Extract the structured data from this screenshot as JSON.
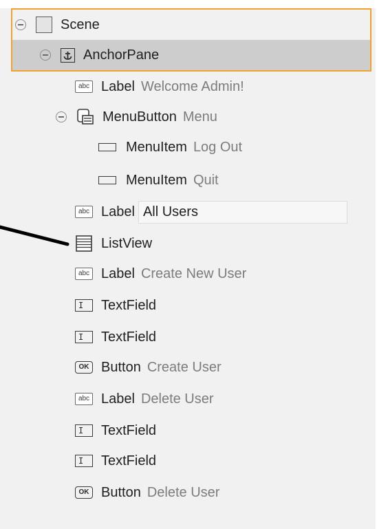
{
  "hierarchy": {
    "scene": {
      "type": "Scene",
      "icon": "scene-icon"
    },
    "anchor": {
      "type": "AnchorPane",
      "icon": "anchor-icon",
      "glyph": "⚓"
    },
    "items": [
      {
        "type": "Label",
        "detail": "Welcome Admin!",
        "icon": "label-icon"
      },
      {
        "type": "MenuButton",
        "detail": "Menu",
        "icon": "menubutton-icon"
      },
      {
        "type": "MenuItem",
        "detail": "Log Out",
        "icon": "menuitem-icon"
      },
      {
        "type": "MenuItem",
        "detail": "Quit",
        "icon": "menuitem-icon"
      },
      {
        "type": "Label",
        "detail": "All Users",
        "icon": "label-icon"
      },
      {
        "type": "ListView",
        "detail": "",
        "icon": "listview-icon"
      },
      {
        "type": "Label",
        "detail": "Create New User",
        "icon": "label-icon"
      },
      {
        "type": "TextField",
        "detail": "",
        "icon": "textfield-icon"
      },
      {
        "type": "TextField",
        "detail": "",
        "icon": "textfield-icon"
      },
      {
        "type": "Button",
        "detail": "Create User",
        "icon": "button-icon"
      },
      {
        "type": "Label",
        "detail": "Delete User",
        "icon": "label-icon"
      },
      {
        "type": "TextField",
        "detail": "",
        "icon": "textfield-icon"
      },
      {
        "type": "TextField",
        "detail": "",
        "icon": "textfield-icon"
      },
      {
        "type": "Button",
        "detail": "Delete User",
        "icon": "button-icon"
      }
    ]
  },
  "icon_glyphs": {
    "abc": "abc",
    "ok": "OK",
    "text": "I"
  },
  "colors": {
    "selection_outline": "#f0a12e",
    "selected_row": "#cdcdcd",
    "panel_bg": "#f1f1f1",
    "detail_text": "#7c7c7c"
  }
}
